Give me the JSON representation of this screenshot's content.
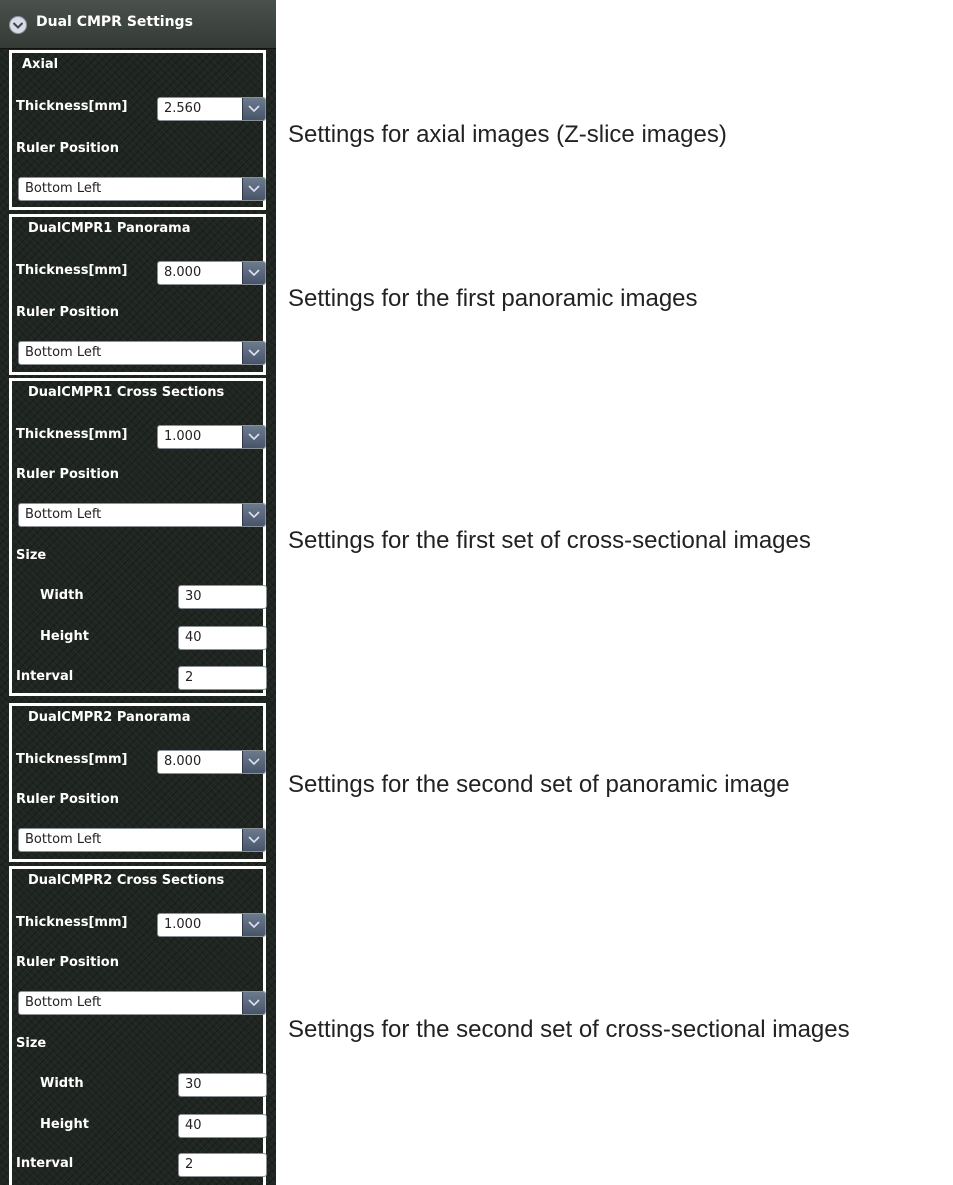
{
  "panel": {
    "title": "Dual CMPR Settings",
    "sections": [
      {
        "title": "Axial",
        "thickness_label": "Thickness[mm]",
        "thickness": "2.560",
        "ruler_label": "Ruler Position",
        "ruler": "Bottom Left"
      },
      {
        "title": "DualCMPR1 Panorama",
        "thickness_label": "Thickness[mm]",
        "thickness": "8.000",
        "ruler_label": "Ruler Position",
        "ruler": "Bottom Left"
      },
      {
        "title": "DualCMPR1 Cross Sections",
        "thickness_label": "Thickness[mm]",
        "thickness": "1.000",
        "ruler_label": "Ruler Position",
        "ruler": "Bottom Left",
        "size_label": "Size",
        "width_label": "Width",
        "width": "30",
        "height_label": "Height",
        "height": "40",
        "interval_label": "Interval",
        "interval": "2"
      },
      {
        "title": "DualCMPR2 Panorama",
        "thickness_label": "Thickness[mm]",
        "thickness": "8.000",
        "ruler_label": "Ruler Position",
        "ruler": "Bottom Left"
      },
      {
        "title": "DualCMPR2 Cross Sections",
        "thickness_label": "Thickness[mm]",
        "thickness": "1.000",
        "ruler_label": "Ruler Position",
        "ruler": "Bottom Left",
        "size_label": "Size",
        "width_label": "Width",
        "width": "30",
        "height_label": "Height",
        "height": "40",
        "interval_label": "Interval",
        "interval": "2"
      }
    ]
  },
  "captions": [
    "Settings for axial images (Z-slice images)",
    "Settings for the first panoramic images",
    "Settings for the first set of cross-sectional images",
    "Settings for the second set of panoramic image",
    "Settings for the second set of cross-sectional images"
  ],
  "colors": {
    "panel_bg": "#1f2521",
    "outline": "#ffffff",
    "dropdown_button": "#5b6880"
  },
  "icons": {
    "header": "chevron-down-circle-icon",
    "dropdown": "chevron-down-icon"
  }
}
